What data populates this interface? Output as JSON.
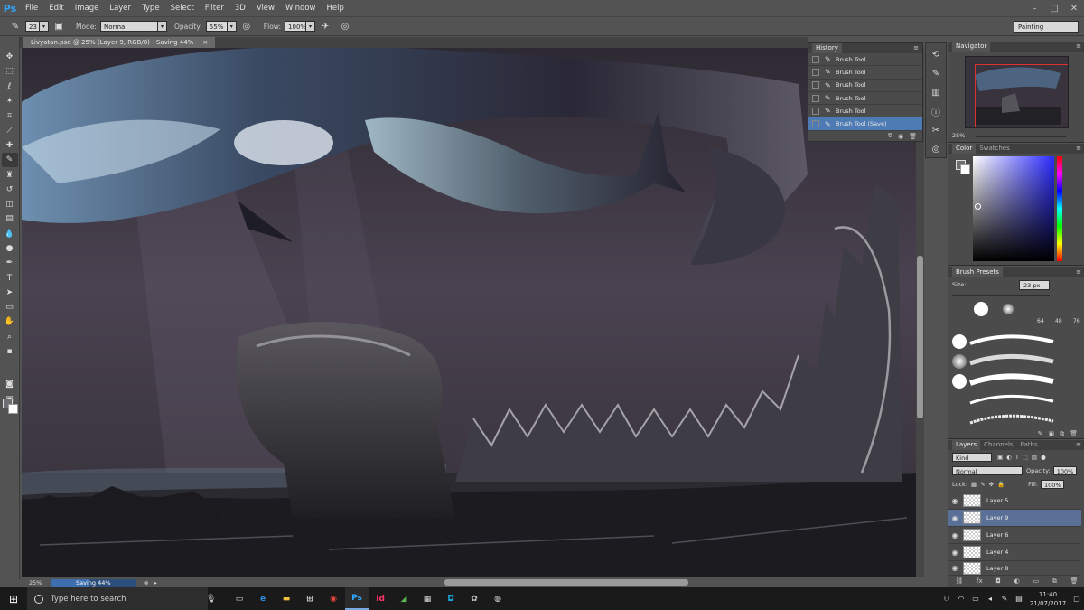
{
  "app": {
    "logo": "Ps",
    "menu": [
      "File",
      "Edit",
      "Image",
      "Layer",
      "Type",
      "Select",
      "Filter",
      "3D",
      "View",
      "Window",
      "Help"
    ],
    "window_controls": [
      "–",
      "□",
      "✕"
    ]
  },
  "options": {
    "brush_size": "23",
    "mode_label": "Mode:",
    "mode_value": "Normal",
    "opacity_label": "Opacity:",
    "opacity_value": "55%",
    "flow_label": "Flow:",
    "flow_value": "100%",
    "workspace": "Painting"
  },
  "document": {
    "tab_title": "Livyatan.psd @ 25% (Layer 9, RGB/8) - Saving 44%",
    "tab_close": "×"
  },
  "status": {
    "zoom": "25%",
    "progress_label": "Saving 44%",
    "progress_fraction": 0.44
  },
  "history": {
    "title": "History",
    "items": [
      "Brush Tool",
      "Brush Tool",
      "Brush Tool",
      "Brush Tool",
      "Brush Tool",
      "Brush Tool (Save)"
    ],
    "selected_index": 5
  },
  "navigator": {
    "title": "Navigator",
    "zoom": "25%"
  },
  "color": {
    "tabs": [
      "Color",
      "Swatches"
    ],
    "foreground": "#6e6e72",
    "background": "#ffffff"
  },
  "brush_presets": {
    "title": "Brush Presets",
    "size_label": "Size:",
    "size_value": "23 px",
    "tip_labels": [
      "64",
      "48",
      "76"
    ]
  },
  "layers": {
    "tabs": [
      "Layers",
      "Channels",
      "Paths"
    ],
    "filter_kind": "Kind",
    "blend_mode": "Normal",
    "opacity_label": "Opacity:",
    "opacity_value": "100%",
    "lock_label": "Lock:",
    "fill_label": "Fill:",
    "fill_value": "100%",
    "items": [
      {
        "name": "Layer 5",
        "selected": false
      },
      {
        "name": "Layer 9",
        "selected": true
      },
      {
        "name": "Layer 6",
        "selected": false
      },
      {
        "name": "Layer 4",
        "selected": false
      },
      {
        "name": "Layer 8",
        "selected": false
      }
    ]
  },
  "taskbar": {
    "search_placeholder": "Type here to search",
    "apps": [
      "Task View",
      "Edge",
      "File Explorer",
      "Store",
      "Chrome",
      "Ps",
      "Id",
      "Maps",
      "Calculator",
      "Camera",
      "Paint",
      "Sync"
    ],
    "time": "11:40",
    "date": "21/07/2017"
  }
}
